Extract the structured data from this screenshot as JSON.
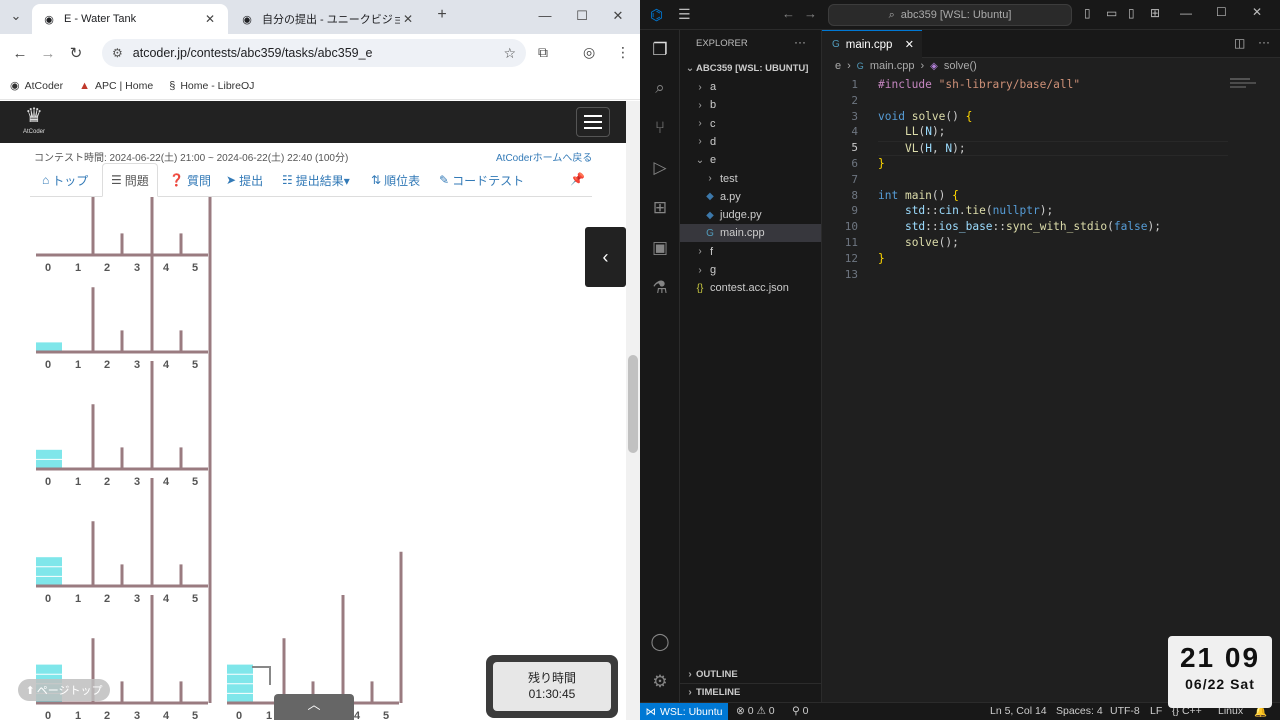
{
  "browser": {
    "tabs": [
      {
        "title": "E - Water Tank",
        "active": true
      },
      {
        "title": "自分の提出 - ユニークビジョンプログ",
        "active": false
      }
    ],
    "url": "atcoder.jp/contests/abc359/tasks/abc359_e",
    "bookmarks": [
      "AtCoder",
      "APC | Home",
      "Home - LibreOJ"
    ],
    "contest_time": "コンテスト時間: 2024-06-22(土) 21:00 ~ 2024-06-22(土) 22:40 (100分)",
    "home_link": "AtCoderホームへ戻る",
    "subtabs": [
      "トップ",
      "問題",
      "質問",
      "提出",
      "提出結果▾",
      "順位表",
      "コードテスト"
    ],
    "logo_text": "AtCoder",
    "figure_labels": [
      "0",
      "1",
      "2",
      "3",
      "4",
      "5"
    ],
    "figures": [
      {
        "heights": [
          0,
          3,
          1,
          3,
          1,
          3
        ],
        "water": 0
      },
      {
        "heights": [
          0,
          3,
          1,
          5,
          1,
          7
        ],
        "water": 1
      },
      {
        "heights": [
          0,
          3,
          1,
          5,
          1,
          7
        ],
        "water": 2
      },
      {
        "heights": [
          0,
          3,
          1,
          5,
          1,
          7
        ],
        "water": 3
      },
      {
        "heights": [
          0,
          3,
          1,
          5,
          1,
          7
        ],
        "water": 4
      }
    ],
    "page_top": "ページトップ",
    "timer_label": "残り時間",
    "timer_value": "01:30:45"
  },
  "vscode": {
    "search": "abc359 [WSL: Ubuntu]",
    "explorer_title": "EXPLORER",
    "workspace": "ABC359 [WSL: UBUNTU]",
    "tree": [
      {
        "label": "a",
        "type": "folder",
        "depth": 0
      },
      {
        "label": "b",
        "type": "folder",
        "depth": 0
      },
      {
        "label": "c",
        "type": "folder",
        "depth": 0
      },
      {
        "label": "d",
        "type": "folder",
        "depth": 0
      },
      {
        "label": "e",
        "type": "folder-open",
        "depth": 0
      },
      {
        "label": "test",
        "type": "folder",
        "depth": 1
      },
      {
        "label": "a.py",
        "type": "py",
        "depth": 1
      },
      {
        "label": "judge.py",
        "type": "py",
        "depth": 1
      },
      {
        "label": "main.cpp",
        "type": "cpp",
        "depth": 1,
        "selected": true
      },
      {
        "label": "f",
        "type": "folder",
        "depth": 0
      },
      {
        "label": "g",
        "type": "folder",
        "depth": 0
      },
      {
        "label": "contest.acc.json",
        "type": "json",
        "depth": 0
      }
    ],
    "outline": "OUTLINE",
    "timeline": "TIMELINE",
    "editor_tab": "main.cpp",
    "breadcrumbs": [
      "e",
      "main.cpp",
      "solve()"
    ],
    "code_lines": [
      "#include \"sh-library/base/all\"",
      "",
      "void solve() {",
      "    LL(N);",
      "    VL(H, N);",
      "}",
      "",
      "int main() {",
      "    std::cin.tie(nullptr);",
      "    std::ios_base::sync_with_stdio(false);",
      "    solve();",
      "}",
      ""
    ],
    "active_line": 5,
    "status": {
      "remote": "WSL: Ubuntu",
      "problems": "⊗ 0  ⚠ 0",
      "ports": "0",
      "position": "Ln 5, Col 14",
      "spaces": "Spaces: 4",
      "encoding": "UTF-8",
      "eol": "LF",
      "language": "C++",
      "os": "Linux"
    }
  },
  "clock": {
    "time": "21 09",
    "date": "06/22 Sat"
  },
  "colors": {
    "water": "#7fe6ea",
    "bar": "#9a7b80",
    "accent": "#0078d4"
  }
}
